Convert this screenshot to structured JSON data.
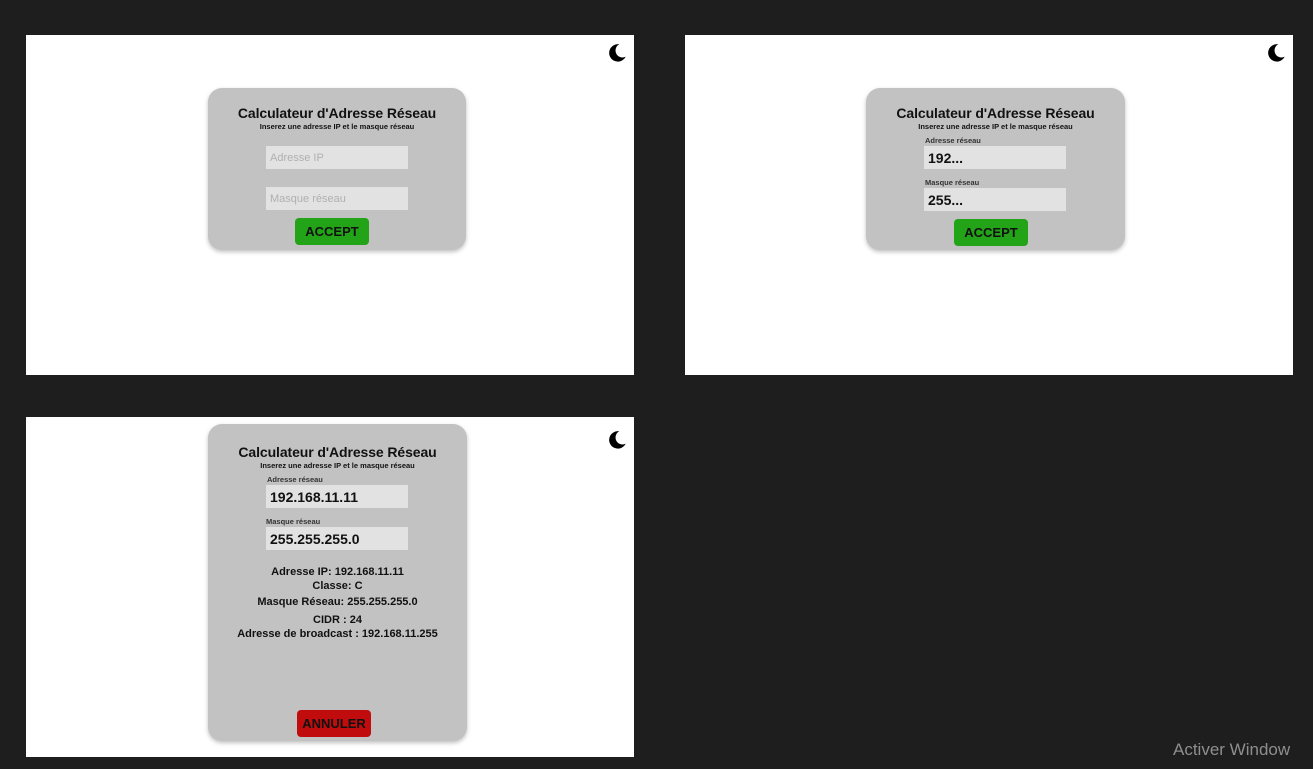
{
  "screens": [
    {
      "title": "Calculateur d'Adresse Réseau",
      "subtitle": "Inserez une adresse IP et le masque réseau",
      "ip_placeholder": "Adresse IP",
      "mask_placeholder": "Masque réseau",
      "button_label": "ACCEPT",
      "theme_icon": "moon-icon"
    },
    {
      "title": "Calculateur d'Adresse Réseau",
      "subtitle": "Inserez une adresse IP et le masque réseau",
      "ip_label": "Adresse réseau",
      "ip_value": "192...",
      "mask_label": "Masque réseau",
      "mask_value": "255...",
      "button_label": "ACCEPT",
      "theme_icon": "moon-icon"
    },
    {
      "title": "Calculateur d'Adresse Réseau",
      "subtitle": "Inserez une adresse IP et le masque réseau",
      "ip_label": "Adresse réseau",
      "ip_value": "192.168.11.11",
      "mask_label": "Masque réseau",
      "mask_value": "255.255.255.0",
      "results": [
        "Adresse IP: 192.168.11.11",
        "Classe: C",
        "Masque Réseau: 255.255.255.0",
        "CIDR : 24",
        "Adresse de broadcast : 192.168.11.255"
      ],
      "button_label": "ANNULER",
      "theme_icon": "moon-icon"
    }
  ],
  "watermark": "Activer Window",
  "colors": {
    "background": "#1e1e1e",
    "card": "#c2c2c2",
    "field": "#e2e2e2",
    "accept": "#23a318",
    "cancel": "#c00c0c"
  }
}
